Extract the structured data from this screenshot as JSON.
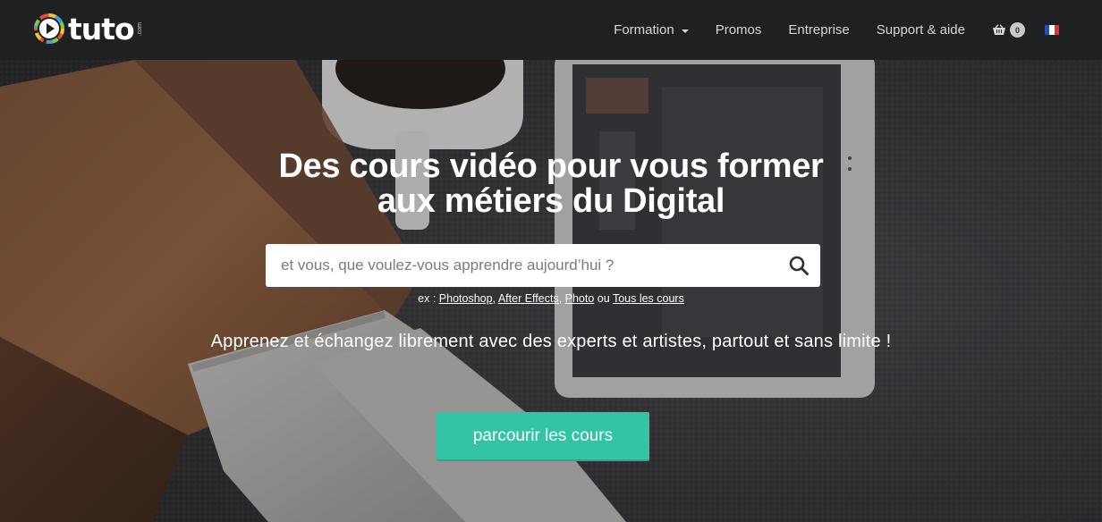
{
  "brand": {
    "name": "tuto",
    "suffix": ".com"
  },
  "nav": {
    "items": [
      {
        "label": "Formation",
        "has_dropdown": true
      },
      {
        "label": "Promos"
      },
      {
        "label": "Entreprise"
      },
      {
        "label": "Support & aide"
      }
    ],
    "cart_count": "0",
    "language_flag": "fr-flag"
  },
  "hero": {
    "headline_line1": "Des cours vidéo pour vous former",
    "headline_line2": "aux métiers du Digital",
    "search": {
      "placeholder": "et vous, que voulez-vous apprendre aujourd’hui ?",
      "button_icon": "search-icon"
    },
    "examples": {
      "prefix": "ex : ",
      "links": [
        "Photoshop",
        "After Effects",
        "Photo"
      ],
      "sep1": ", ",
      "sep2": ", ",
      "or": " ou ",
      "all_link": "Tous les cours"
    },
    "tagline": "Apprenez et échangez librement avec des experts et artistes, partout et sans limite !",
    "cta_label": "parcourir les cours"
  },
  "colors": {
    "navbar_bg": "#1f2022",
    "accent": "#33c4a4",
    "flag_blue": "#2b4fa8",
    "flag_white": "#ffffff",
    "flag_red": "#e0303a"
  }
}
